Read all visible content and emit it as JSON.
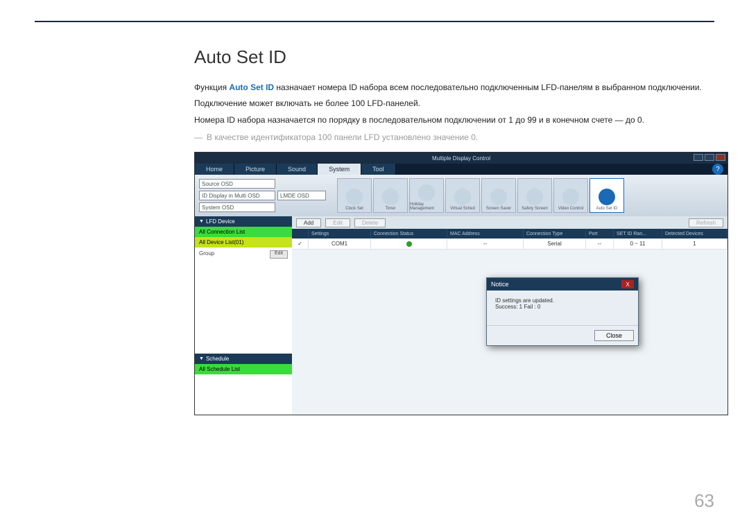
{
  "doc": {
    "heading": "Auto Set ID",
    "p1_a": "Функция ",
    "p1_b": "Auto Set ID",
    "p1_c": " назначает номера ID набора всем последовательно подключенным LFD-панелям в выбранном подключении.",
    "p2": "Подключение может включать не более 100 LFD-панелей.",
    "p3": "Номера ID набора назначается по порядку в последовательном подключении от 1 до 99 и в конечном счете — до 0.",
    "note": "В качестве идентификатора 100 панели LFD установлено значение 0.",
    "page_number": "63"
  },
  "app": {
    "title": "Multiple Display Control",
    "tabs": [
      "Home",
      "Picture",
      "Sound",
      "System",
      "Tool"
    ],
    "active_tab": "System",
    "help": "?",
    "selects": [
      "Source OSD",
      "ID Display in Multi OSD",
      "System OSD"
    ],
    "select_val2": "LMDE OSD",
    "ribbon_items": [
      "Clock Set",
      "Timer",
      "Holiday Management",
      "Virtual Sched",
      "Screen Saver",
      "Safety Screen",
      "Video Control",
      "Auto Set ID"
    ],
    "sidebar": {
      "lfd_header": "LFD Device",
      "conn_list": "All Connection List",
      "device_list": "All Device List(01)",
      "group": "Group",
      "edit": "Edit",
      "schedule_header": "Schedule",
      "schedule_list": "All Schedule List"
    },
    "toolbar2": {
      "add": "Add",
      "edit": "Edit",
      "delete": "Delete",
      "refresh": "Refresh"
    },
    "columns": [
      "",
      "Settings",
      "Connection Status",
      "MAC Address",
      "Connection Type",
      "Port",
      "SET ID Ran...",
      "Detected Devices"
    ],
    "row": {
      "check": "✓",
      "settings": "COM1",
      "mac": "--",
      "type": "Serial",
      "port": "--",
      "range": "0 ~ 11",
      "detected": "1"
    },
    "dialog": {
      "title": "Notice",
      "line1": "ID settings are updated.",
      "line2": "Success: 1  Fail : 0",
      "close": "Close",
      "x": "X"
    }
  }
}
